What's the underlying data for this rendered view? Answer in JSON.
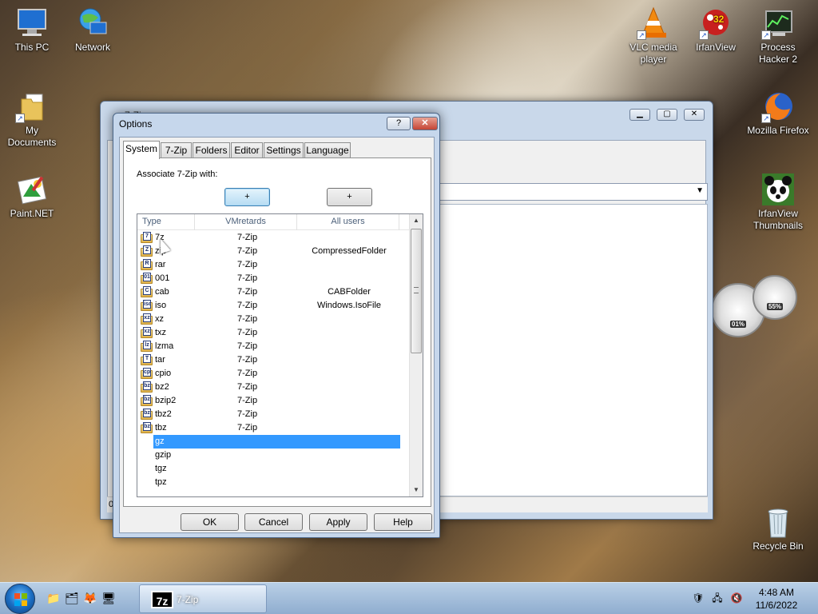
{
  "desktop": {
    "icons": [
      {
        "id": "this-pc",
        "label": "This PC",
        "glyph": "🖥"
      },
      {
        "id": "network",
        "label": "Network",
        "glyph": "🌐"
      },
      {
        "id": "my-documents",
        "label": "My Documents",
        "glyph": "📁"
      },
      {
        "id": "paint-net",
        "label": "Paint.NET",
        "glyph": "🎨"
      },
      {
        "id": "vlc",
        "label": "VLC media player",
        "glyph": "🔶"
      },
      {
        "id": "irfanview",
        "label": "IrfanView",
        "glyph": "🐞"
      },
      {
        "id": "process-hacker",
        "label": "Process Hacker 2",
        "glyph": "📊"
      },
      {
        "id": "firefox",
        "label": "Mozilla Firefox",
        "glyph": "🦊"
      },
      {
        "id": "irfanview-thumbs",
        "label": "IrfanView Thumbnails",
        "glyph": "🐼"
      },
      {
        "id": "recycle-bin",
        "label": "Recycle Bin",
        "glyph": "🗑"
      }
    ],
    "irfanview_badge": "32",
    "gadget": {
      "cpu": "01%",
      "mem": "55%"
    }
  },
  "main_window": {
    "title": "7-Zip",
    "status_text": "0"
  },
  "dialog": {
    "title": "Options",
    "help_glyph": "?",
    "close_glyph": "✕",
    "tabs": [
      "System",
      "7-Zip",
      "Folders",
      "Editor",
      "Settings",
      "Language"
    ],
    "active_tab": "System",
    "associate_label": "Associate 7-Zip with:",
    "plus_user": "+",
    "plus_all": "+",
    "columns": {
      "type": "Type",
      "user": "VMretards",
      "all": "All users"
    },
    "rows": [
      {
        "ext": "7z",
        "user": "7-Zip",
        "all": "",
        "badge": "7"
      },
      {
        "ext": "zip",
        "user": "7-Zip",
        "all": "CompressedFolder",
        "badge": "Z"
      },
      {
        "ext": "rar",
        "user": "7-Zip",
        "all": "",
        "badge": "R"
      },
      {
        "ext": "001",
        "user": "7-Zip",
        "all": "",
        "badge": "01"
      },
      {
        "ext": "cab",
        "user": "7-Zip",
        "all": "CABFolder",
        "badge": "C"
      },
      {
        "ext": "iso",
        "user": "7-Zip",
        "all": "Windows.IsoFile",
        "badge": "iso"
      },
      {
        "ext": "xz",
        "user": "7-Zip",
        "all": "",
        "badge": "xz"
      },
      {
        "ext": "txz",
        "user": "7-Zip",
        "all": "",
        "badge": "xz"
      },
      {
        "ext": "lzma",
        "user": "7-Zip",
        "all": "",
        "badge": "lz"
      },
      {
        "ext": "tar",
        "user": "7-Zip",
        "all": "",
        "badge": "T"
      },
      {
        "ext": "cpio",
        "user": "7-Zip",
        "all": "",
        "badge": "cp"
      },
      {
        "ext": "bz2",
        "user": "7-Zip",
        "all": "",
        "badge": "bz"
      },
      {
        "ext": "bzip2",
        "user": "7-Zip",
        "all": "",
        "badge": "bz"
      },
      {
        "ext": "tbz2",
        "user": "7-Zip",
        "all": "",
        "badge": "bz"
      },
      {
        "ext": "tbz",
        "user": "7-Zip",
        "all": "",
        "badge": "bz"
      },
      {
        "ext": "gz",
        "user": "",
        "all": "",
        "badge": "",
        "selected": true
      },
      {
        "ext": "gzip",
        "user": "",
        "all": "",
        "badge": ""
      },
      {
        "ext": "tgz",
        "user": "",
        "all": "",
        "badge": ""
      },
      {
        "ext": "tpz",
        "user": "",
        "all": "",
        "badge": ""
      }
    ],
    "buttons": {
      "ok": "OK",
      "cancel": "Cancel",
      "apply": "Apply",
      "help": "Help"
    }
  },
  "taskbar": {
    "task_label": "7-Zip",
    "task_logo": "7z",
    "time": "4:48 AM",
    "date": "11/6/2022"
  }
}
